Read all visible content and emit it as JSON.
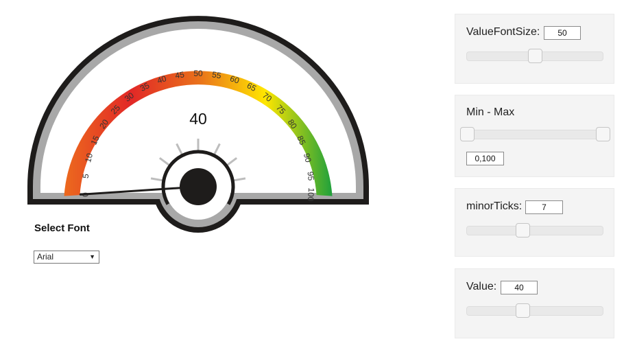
{
  "gauge": {
    "value": 40,
    "value_display": "40",
    "min": 0,
    "max": 100,
    "major_step": 5,
    "minor_ticks": 7,
    "tick_labels": [
      "0",
      "5",
      "10",
      "15",
      "20",
      "25",
      "30",
      "35",
      "40",
      "45",
      "50",
      "55",
      "60",
      "65",
      "70",
      "75",
      "80",
      "85",
      "90",
      "95",
      "100"
    ],
    "colors": {
      "frame": "#1e1c1b",
      "ring": "#a8a8a8",
      "face": "#ffffff",
      "needle": "#1e1c1b",
      "hub_ring": "#1e1c1b",
      "minor_tick": "#bdbdbd",
      "band": [
        "#ec6a1e",
        "#e22827",
        "#e9701b",
        "#ffe600",
        "#1ea03c"
      ]
    }
  },
  "font": {
    "title": "Select Font",
    "selected": "Arial",
    "caret_icon": "dropdown-caret-icon",
    "caret_glyph": "▼"
  },
  "controls": {
    "value_font_size": {
      "label": "ValueFontSize:",
      "value": "50",
      "level": 0.5
    },
    "min_max": {
      "label": "Min - Max",
      "value": "0,100",
      "low": 0,
      "high": 1
    },
    "minor_ticks": {
      "label": "minorTicks:",
      "value": "7",
      "level": 0.41
    },
    "value": {
      "label": "Value:",
      "value": "40",
      "level": 0.41
    }
  }
}
